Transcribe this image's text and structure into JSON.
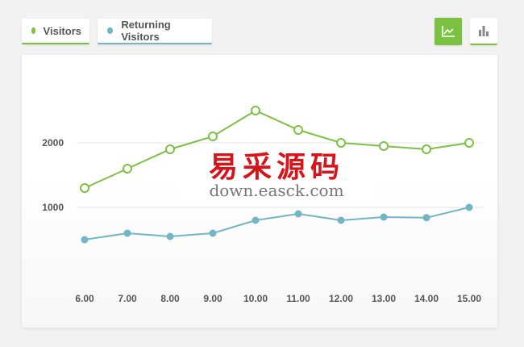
{
  "legend": {
    "visitors_label": "Visitors",
    "returning_label": "Returning Visitors"
  },
  "toolbar": {
    "line_view_icon": "line-chart-icon",
    "bar_view_icon": "bar-chart-icon",
    "active_view": "line"
  },
  "colors": {
    "visitors": "#7cc242",
    "returning": "#72b5c7",
    "accent": "#7cc242"
  },
  "watermark": {
    "brand": "易采源码",
    "url": "down.easck.com"
  },
  "chart_data": {
    "type": "line",
    "categories": [
      "6.00",
      "7.00",
      "8.00",
      "9.00",
      "10.00",
      "11.00",
      "12.00",
      "13.00",
      "14.00",
      "15.00"
    ],
    "series": [
      {
        "name": "Visitors",
        "values": [
          1300,
          1600,
          1900,
          2100,
          2500,
          2200,
          2000,
          1950,
          1900,
          2000
        ]
      },
      {
        "name": "Returning Visitors",
        "values": [
          500,
          600,
          550,
          600,
          800,
          900,
          800,
          850,
          840,
          1000
        ]
      }
    ],
    "yticks": [
      1000,
      2000
    ],
    "ylabel": "",
    "xlabel": "",
    "grid": true,
    "legend_position": "top-left"
  }
}
